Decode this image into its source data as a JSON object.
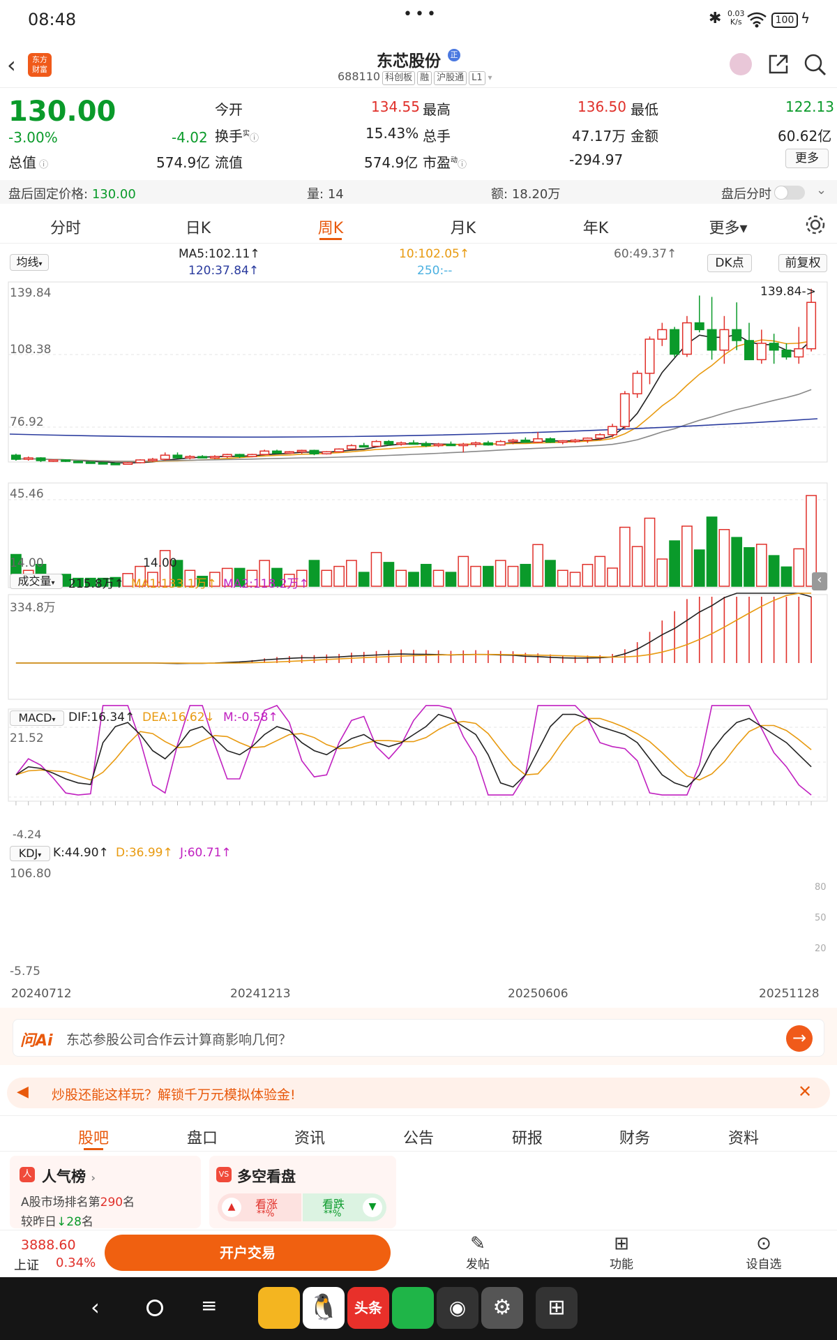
{
  "status": {
    "time": "08:48",
    "net_speed_top": "0.03",
    "net_speed_bottom": "K/s",
    "battery": "100"
  },
  "header": {
    "title": "东芯股份",
    "code": "688110",
    "chips": [
      "科创板",
      "融",
      "沪股通",
      "L1"
    ],
    "logo_line1": "东方",
    "logo_line2": "财富"
  },
  "quote": {
    "price": "130.00",
    "pct": "-3.00%",
    "chg": "-4.02",
    "l_total": "总值",
    "v_total": "574.9亿",
    "l_open": "今开",
    "v_open": "134.55",
    "l_turn": "换手",
    "v_turn": "15.43%",
    "l_float": "流值",
    "v_float": "574.9亿",
    "l_high": "最高",
    "v_high": "136.50",
    "l_hand": "总手",
    "v_hand": "47.17万",
    "l_pe": "市盈",
    "v_pe": "-294.97",
    "l_low": "最低",
    "v_low": "122.13",
    "l_amt": "金额",
    "v_amt": "60.62亿",
    "more": "更多",
    "sup_shi": "实",
    "sup_dong": "动"
  },
  "after": {
    "fixed_label": "盘后固定价格:",
    "fixed_value": "130.00",
    "vol_label": "量:",
    "vol_value": "14",
    "amt_label": "额:",
    "amt_value": "18.20万",
    "toggle_label": "盘后分时"
  },
  "chart_tabs": [
    "分时",
    "日K",
    "周K",
    "月K",
    "年K",
    "更多▾"
  ],
  "active_tab": "周K",
  "ma_bar": {
    "select": "均线",
    "ma5": "MA5:102.11↑",
    "ma10": "10:102.05↑",
    "ma60": "60:49.37↑",
    "ma120": "120:37.84↑",
    "ma250": "250:--",
    "dk": "DK点",
    "fq": "前复权"
  },
  "price_axis": [
    "139.84",
    "108.38",
    "76.92",
    "45.46",
    "14.00"
  ],
  "max_label": "139.84->",
  "min_label": "14.00",
  "vol_bar": {
    "select": "成交量",
    "v": "215.8万↑",
    "ma1": "MA1:133.1万↑",
    "ma2": "MA2:118.2万↑",
    "max": "334.8万"
  },
  "macd_bar": {
    "select": "MACD",
    "dif": "DIF:16.34↑",
    "dea": "DEA:16.62↓",
    "m": "M:-0.58↑",
    "max": "21.52",
    "min": "-4.24"
  },
  "kdj_bar": {
    "select": "KDJ",
    "k": "K:44.90↑",
    "d": "D:36.99↑",
    "j": "J:60.71↑",
    "max": "106.80",
    "min": "-5.75",
    "r80": "80",
    "r50": "50",
    "r20": "20"
  },
  "dates": [
    "20240712",
    "20241213",
    "20250606",
    "20251128"
  ],
  "ai": {
    "logo": "问Ai",
    "question": "东芯参股公司合作云计算商影响几何？"
  },
  "promo": {
    "text": "炒股还能这样玩？解锁千万元模拟体验金!"
  },
  "sub_tabs": [
    "股吧",
    "盘口",
    "资讯",
    "公告",
    "研报",
    "财务",
    "资料"
  ],
  "popular": {
    "title": "人气榜",
    "rank_text": "A股市场排名第",
    "rank": "290",
    "rank_suffix": "名",
    "prev_text": "较昨日",
    "prev_change": "28",
    "prev_suffix": "名"
  },
  "bullbear": {
    "title": "多空看盘",
    "up": "看涨",
    "up_pct": "**%",
    "down": "看跌",
    "down_pct": "**%"
  },
  "bottom": {
    "index": "3888.60",
    "index_name": "上证",
    "index_pct": "0.34%",
    "open_btn": "开户交易",
    "post": "发帖",
    "func": "功能",
    "watch": "设自选"
  },
  "chart_data": {
    "type": "candlestick",
    "series_count": 64,
    "ohlc": [
      [
        18,
        19,
        14,
        15
      ],
      [
        15,
        17,
        14,
        16
      ],
      [
        16,
        16.5,
        13,
        14
      ],
      [
        14,
        15,
        13,
        14.5
      ],
      [
        14.5,
        15,
        13,
        13.5
      ],
      [
        13.5,
        14,
        12.5,
        13
      ],
      [
        13,
        13.5,
        12,
        12.5
      ],
      [
        12.5,
        13,
        11.5,
        12
      ],
      [
        12,
        12.5,
        11,
        11.3
      ],
      [
        11.3,
        13,
        11,
        12.5
      ],
      [
        12.5,
        15,
        12,
        14.5
      ],
      [
        14.5,
        16,
        13,
        15
      ],
      [
        15,
        20,
        14,
        18
      ],
      [
        18,
        20,
        15.5,
        16
      ],
      [
        16,
        18,
        15,
        17
      ],
      [
        17,
        18,
        16,
        16.5
      ],
      [
        16.5,
        18,
        15,
        17
      ],
      [
        17,
        19,
        16,
        18.5
      ],
      [
        18.5,
        19,
        16,
        17
      ],
      [
        17,
        19,
        16.5,
        18.5
      ],
      [
        18.5,
        22,
        18,
        21
      ],
      [
        21,
        22,
        19,
        19.5
      ],
      [
        19.5,
        21,
        19,
        20.5
      ],
      [
        20.5,
        22,
        19,
        21.5
      ],
      [
        21.5,
        22,
        18,
        19
      ],
      [
        19,
        21,
        18.5,
        20.5
      ],
      [
        20.5,
        23,
        20,
        22.5
      ],
      [
        22.5,
        26,
        22,
        25
      ],
      [
        25,
        27,
        24,
        24.5
      ],
      [
        24.5,
        29,
        24,
        28
      ],
      [
        28,
        29,
        25,
        26
      ],
      [
        26,
        28,
        25,
        27
      ],
      [
        27,
        29,
        26,
        26.5
      ],
      [
        26.5,
        28,
        24,
        25
      ],
      [
        25,
        27,
        24,
        26
      ],
      [
        26,
        28,
        25,
        25.5
      ],
      [
        25.5,
        27,
        20,
        26
      ],
      [
        26,
        28,
        24,
        27
      ],
      [
        27,
        28.5,
        25,
        25.5
      ],
      [
        25.5,
        29,
        25,
        28
      ],
      [
        28,
        30,
        26,
        29
      ],
      [
        29,
        31,
        27,
        27.5
      ],
      [
        27.5,
        35,
        27,
        30
      ],
      [
        30,
        31,
        27,
        27.5
      ],
      [
        27.5,
        29,
        26,
        28.5
      ],
      [
        28.5,
        30,
        27,
        29
      ],
      [
        29,
        31,
        27,
        30.5
      ],
      [
        30.5,
        34,
        29,
        33
      ],
      [
        33,
        41,
        31,
        39
      ],
      [
        39,
        65,
        37,
        63
      ],
      [
        63,
        80,
        60,
        78
      ],
      [
        78,
        105,
        70,
        103
      ],
      [
        103,
        115,
        98,
        110
      ],
      [
        110,
        112,
        90,
        92
      ],
      [
        92,
        120,
        90,
        115
      ],
      [
        115,
        135,
        108,
        110
      ],
      [
        110,
        134,
        88,
        95
      ],
      [
        95,
        120,
        85,
        110
      ],
      [
        110,
        130,
        95,
        102
      ],
      [
        102,
        115,
        95,
        88
      ],
      [
        88,
        110,
        85,
        100
      ],
      [
        100,
        107,
        85,
        95
      ],
      [
        95,
        100,
        88,
        90
      ],
      [
        90,
        112,
        85,
        96
      ],
      [
        96,
        140,
        94,
        130
      ]
    ]
  }
}
